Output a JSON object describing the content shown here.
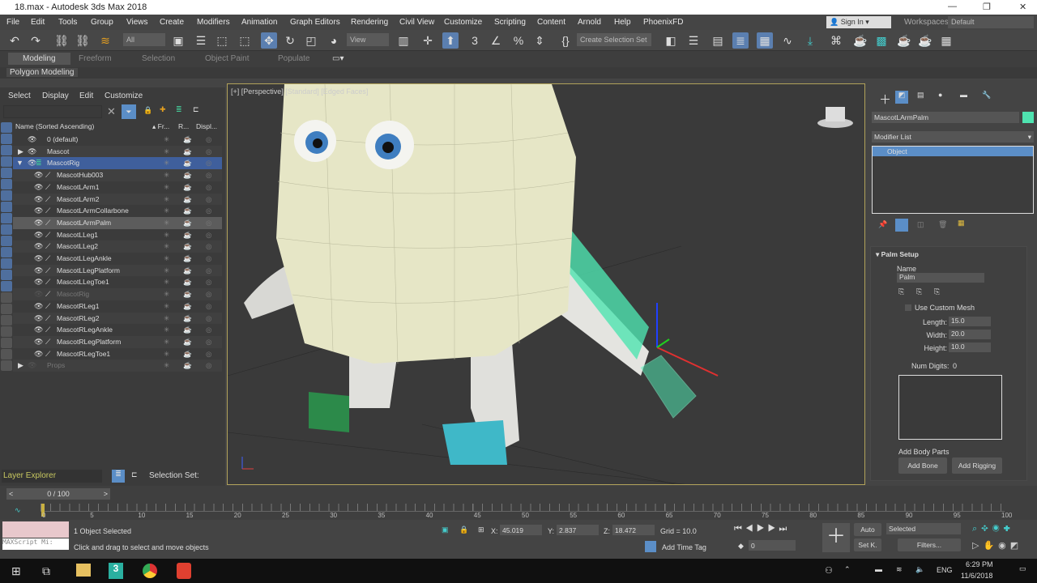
{
  "window": {
    "title": "18.max - Autodesk 3ds Max 2018",
    "min": "—",
    "max": "❐",
    "close": "✕"
  },
  "menu": [
    "File",
    "Edit",
    "Tools",
    "Group",
    "Views",
    "Create",
    "Modifiers",
    "Animation",
    "Graph Editors",
    "Rendering",
    "Civil View",
    "Customize",
    "Scripting",
    "Content",
    "Arnold",
    "Help",
    "PhoenixFD"
  ],
  "account": {
    "sign_in": "Sign In",
    "workspaces_label": "Workspaces:",
    "workspace": "Default"
  },
  "toolbar": {
    "filter": "All",
    "ref_coord": "View",
    "selection_set": "Create Selection Set"
  },
  "ribbon": {
    "tabs": [
      "Modeling",
      "Freeform",
      "Selection",
      "Object Paint",
      "Populate"
    ],
    "active": "Modeling",
    "panel": "Polygon Modeling"
  },
  "explorer": {
    "menus": [
      "Select",
      "Display",
      "Edit",
      "Customize"
    ],
    "columns": {
      "name": "Name (Sorted Ascending)",
      "frozen": "Fr...",
      "render": "R...",
      "display": "Displ..."
    },
    "rows": [
      {
        "name": "0 (default)",
        "state": "layer"
      },
      {
        "name": "Mascot",
        "state": "layer-collapsed"
      },
      {
        "name": "MascotRig",
        "state": "selected-layer"
      },
      {
        "name": "MascotHub003"
      },
      {
        "name": "MascotLArm1"
      },
      {
        "name": "MascotLArm2"
      },
      {
        "name": "MascotLArmCollarbone"
      },
      {
        "name": "MascotLArmPalm",
        "state": "highlighted"
      },
      {
        "name": "MascotLLeg1"
      },
      {
        "name": "MascotLLeg2"
      },
      {
        "name": "MascotLLegAnkle"
      },
      {
        "name": "MascotLLegPlatform"
      },
      {
        "name": "MascotLLegToe1"
      },
      {
        "name": "MascotRig",
        "state": "hidden"
      },
      {
        "name": "MascotRLeg1"
      },
      {
        "name": "MascotRLeg2"
      },
      {
        "name": "MascotRLegAnkle"
      },
      {
        "name": "MascotRLegPlatform"
      },
      {
        "name": "MascotRLegToe1"
      },
      {
        "name": "Props",
        "state": "hidden-layer"
      }
    ],
    "footer": {
      "explorer": "Layer Explorer",
      "selection_set": "Selection Set:"
    }
  },
  "viewport": {
    "label": "[+] [Perspective] [Standard] [Edged Faces]"
  },
  "command_panel": {
    "object_name": "MascotLArmPalm",
    "object_color": "#4fe3b0",
    "modifier_list": "Modifier List",
    "stack": [
      "Object"
    ],
    "rollout": "Palm Setup",
    "name_label": "Name",
    "name_value": "Palm",
    "use_custom_mesh": "Use Custom Mesh",
    "length_label": "Length:",
    "length": "15.0",
    "width_label": "Width:",
    "width": "20.0",
    "height_label": "Height:",
    "height": "10.0",
    "num_digits_label": "Num Digits:",
    "num_digits": "0",
    "add_body_parts": "Add Body Parts",
    "add_bone": "Add Bone",
    "add_rigging": "Add Rigging"
  },
  "timeline": {
    "frame": "0 / 100",
    "ticks": [
      "0",
      "5",
      "10",
      "15",
      "20",
      "25",
      "30",
      "35",
      "40",
      "45",
      "50",
      "55",
      "60",
      "65",
      "70",
      "75",
      "80",
      "85",
      "90",
      "95",
      "100"
    ]
  },
  "status": {
    "selected": "1 Object Selected",
    "prompt": "Click and drag to select and move objects",
    "maxscript": "MAXScript Mi:",
    "x_label": "X:",
    "x": "45.019",
    "y_label": "Y:",
    "y": "2.837",
    "z_label": "Z:",
    "z": "18.472",
    "grid": "Grid = 10.0",
    "add_time_tag": "Add Time Tag",
    "auto": "Auto",
    "set_key": "Set K.",
    "key_filter": "Selected",
    "filters": "Filters...",
    "current_frame": "0"
  },
  "taskbar": {
    "lang": "ENG",
    "time": "6:29 PM",
    "date": "11/6/2018"
  }
}
